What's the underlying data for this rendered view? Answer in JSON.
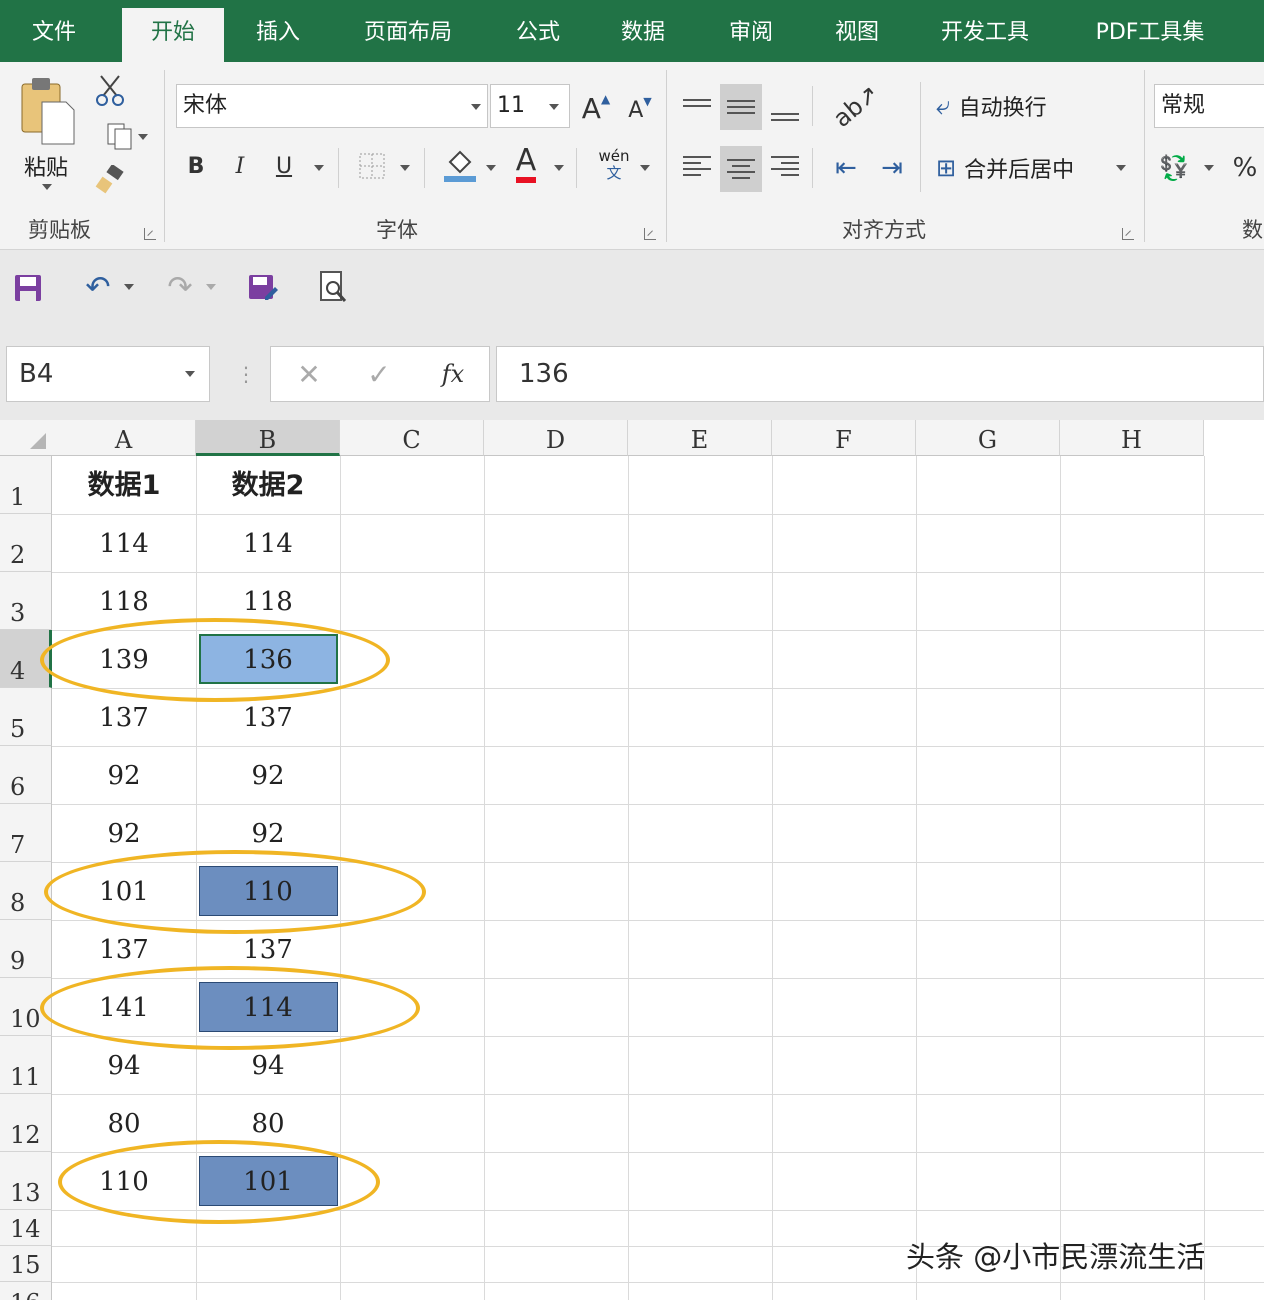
{
  "tabs": [
    "文件",
    "开始",
    "插入",
    "页面布局",
    "公式",
    "数据",
    "审阅",
    "视图",
    "开发工具",
    "PDF工具集"
  ],
  "active_tab": "开始",
  "ribbon": {
    "clipboard": {
      "paste_label": "粘贴",
      "group_label": "剪贴板"
    },
    "font": {
      "font_name": "宋体",
      "font_size": "11",
      "grow_label": "A",
      "shrink_label": "A",
      "bold": "B",
      "italic": "I",
      "underline": "U",
      "font_color_label": "A",
      "phonetic": "wén",
      "phonetic_sub": "文",
      "group_label": "字体",
      "font_color": "#e81123"
    },
    "alignment": {
      "wrap_text": "自动换行",
      "merge_center": "合并后居中",
      "group_label": "对齐方式"
    },
    "number": {
      "format": "常规",
      "percent": "%",
      "group_label": "数"
    }
  },
  "formula_bar": {
    "name_box": "B4",
    "fx": "fx",
    "value": "136"
  },
  "columns": [
    "A",
    "B",
    "C",
    "D",
    "E",
    "F",
    "G",
    "H"
  ],
  "rows": [
    "1",
    "2",
    "3",
    "4",
    "5",
    "6",
    "7",
    "8",
    "9",
    "10",
    "11",
    "12",
    "13",
    "14",
    "15",
    "16"
  ],
  "cells": {
    "A": [
      "数据1",
      "114",
      "118",
      "139",
      "137",
      "92",
      "92",
      "101",
      "137",
      "141",
      "94",
      "80",
      "110",
      "",
      "",
      ""
    ],
    "B": [
      "数据2",
      "114",
      "118",
      "136",
      "137",
      "92",
      "92",
      "110",
      "137",
      "114",
      "94",
      "80",
      "101",
      "",
      "",
      ""
    ]
  },
  "selected_cell": "B4",
  "highlight_colors": {
    "active": "#8db4e2",
    "mismatch": "#6c8ebf"
  },
  "watermark": "头条 @小市民漂流生活"
}
